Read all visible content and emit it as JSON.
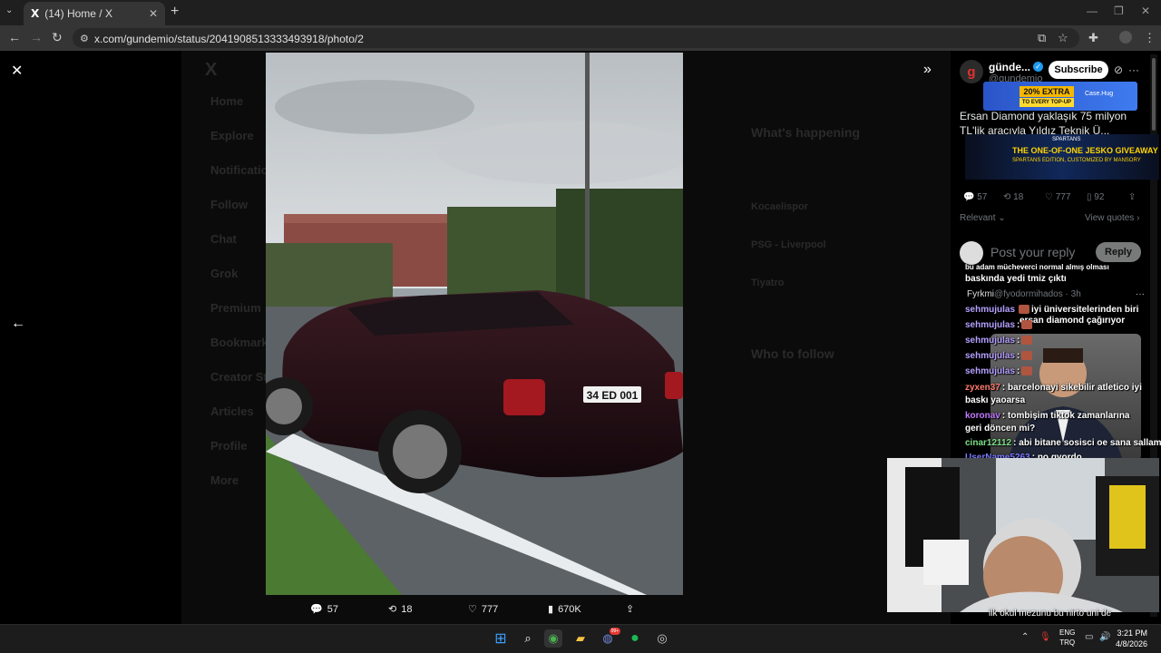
{
  "browser": {
    "tab_title": "(14) Home / X",
    "tab_logo": "X",
    "url": "x.com/gundemio/status/2041908513333493918/photo/2"
  },
  "background_nav": [
    "Home",
    "Explore",
    "Notifications",
    "Follow",
    "Chat",
    "Grok",
    "Premium",
    "Bookmarks",
    "Creator Studio",
    "Articles",
    "Profile",
    "More"
  ],
  "background_right": {
    "whats_happening": "What's happening",
    "who_to_follow": "Who to follow",
    "trends": [
      "Kocaelispor",
      "PSG - Liverpool",
      "Tiyatro"
    ]
  },
  "media": {
    "plate": "34 ED 001",
    "stats": {
      "replies": "57",
      "reposts": "18",
      "likes": "777",
      "views": "670K"
    }
  },
  "post": {
    "account_name": "günde...",
    "handle": "@gundemio",
    "subscribe_label": "Subscribe",
    "text": "Ersan Diamond yaklaşık 75 milyon TL'lik aracıyla Yıldız Teknik Ü...",
    "stats": {
      "replies": "57",
      "reposts": "18",
      "likes": "777",
      "bookmarks": "92"
    },
    "relevant_label": "Relevant",
    "view_quotes_label": "View quotes",
    "reply_placeholder": "Post your reply",
    "reply_button": "Reply"
  },
  "ads": {
    "ad1_badge": "20% EXTRA",
    "ad1_sub": "TO EVERY TOP-UP",
    "ad1_brand": "Case.Hug",
    "ad2_top": "SPARTANS",
    "ad2_title": "THE ONE-OF-ONE JESKO GIVEAWAY",
    "ad2_sub": "SPARTANS EDITION, CUSTOMIZED BY MANSORY"
  },
  "chat": [
    {
      "user": "",
      "text": "bu adam mücheverci normal almış olması"
    },
    {
      "user": "",
      "text": "baskında yedi tmiz çıktı"
    },
    {
      "user": "",
      "text": "iyi üniversitelerinden biri"
    },
    {
      "user": "sehmujulas",
      "text": ":"
    },
    {
      "user": "sehmujulas",
      "text": ":"
    },
    {
      "user": "sehmujulas",
      "text": ":"
    },
    {
      "user": "sehmujulas",
      "text": ":"
    },
    {
      "user": "sehmujulas",
      "text": ":"
    },
    {
      "user": "zyxen37",
      "text": ": barcelonayi sikebilir atletico iyi baskı yaoarsa"
    },
    {
      "user": "koronav",
      "text": ": tombişim tiktok zamanlarına geri döncen mi?"
    },
    {
      "user": "cinar12112",
      "text": ": abi bitane sosisci oe sana sallamış"
    },
    {
      "user": "UserName5263",
      "text": ": no gyordo"
    }
  ],
  "chat_overlay_reply": {
    "handle": "@fyodormihados · 3h",
    "text": "ersan diamond çağırıyor"
  },
  "bottom_chat": "ilk okul mezunu bu nirto uni de",
  "taskbar": {
    "lang_top": "ENG",
    "lang_bottom": "TRQ",
    "time": "3:21 PM",
    "date": "4/8/2026",
    "discord_badge": "99+"
  },
  "colors": {
    "accent": "#1d9bf0",
    "background": "#000000",
    "muted": "#71767b"
  }
}
